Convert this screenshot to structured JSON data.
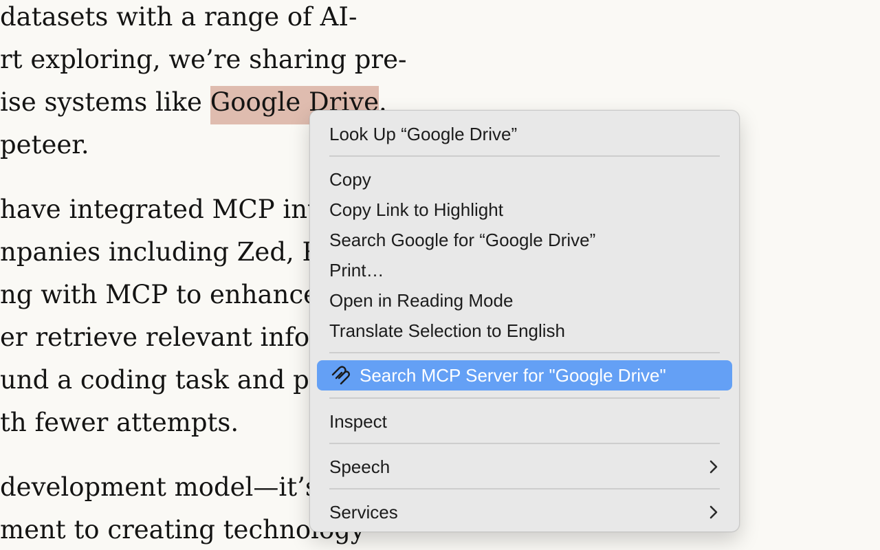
{
  "article": {
    "lines": [
      "datasets with a range of AI-",
      "rt exploring, we’re sharing pre-",
      "ise systems like ",
      ".",
      "peteer.",
      "have integrated MCP into",
      "npanies including Zed, R",
      "ng with MCP to enhance t",
      "er retrieve relevant inforr",
      "und a coding task and pro",
      "th fewer attempts.",
      "development model—it’s",
      "ment to creating technology"
    ],
    "highlighted_text": "Google Drive",
    "highlight_color": "#dfbcaf"
  },
  "context_menu": {
    "look_up": "Look Up “Google Drive”",
    "copy": "Copy",
    "copy_link_to_highlight": "Copy Link to Highlight",
    "search_google": "Search Google for “Google Drive”",
    "print": "Print…",
    "open_reading_mode": "Open in Reading Mode",
    "translate": "Translate Selection to English",
    "search_mcp": "Search MCP Server for \"Google Drive\"",
    "inspect": "Inspect",
    "speech": "Speech",
    "services": "Services",
    "active_color": "#64a0f5",
    "icons": {
      "mcp": "mcp-logo-icon",
      "submenu": "chevron-right-icon"
    }
  }
}
